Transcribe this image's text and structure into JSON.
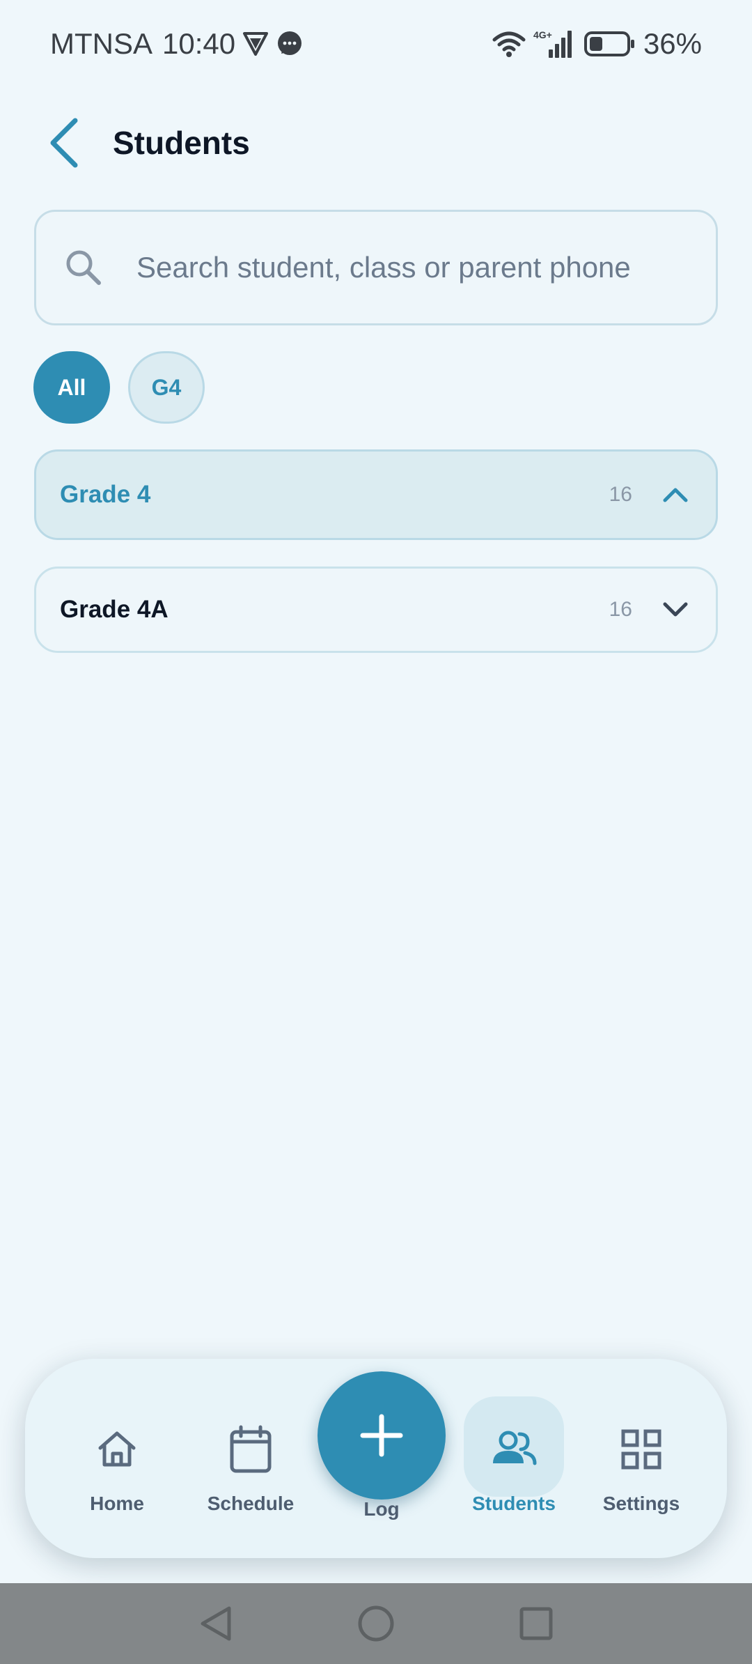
{
  "status_bar": {
    "carrier": "MTNSA",
    "time": "10:40",
    "network": "4G+",
    "battery_percent": "36%",
    "battery_level": 0.36,
    "icons": [
      "vpn-icon",
      "messenger-icon",
      "wifi-icon",
      "signal-icon",
      "battery-icon"
    ]
  },
  "header": {
    "title": "Students",
    "back_icon": "chevron-left-icon"
  },
  "search": {
    "placeholder": "Search student, class or parent phone",
    "value": "",
    "icon": "search-icon"
  },
  "filters": {
    "chips": [
      {
        "label": "All",
        "active": true
      },
      {
        "label": "G4",
        "active": false
      }
    ]
  },
  "groups": [
    {
      "name": "Grade 4",
      "count": "16",
      "expanded": true
    },
    {
      "name": "Grade 4A",
      "count": "16",
      "expanded": false
    }
  ],
  "bottom_nav": {
    "items": [
      {
        "label": "Home",
        "icon": "home-icon",
        "active": false
      },
      {
        "label": "Schedule",
        "icon": "calendar-icon",
        "active": false
      },
      {
        "label": "Log",
        "icon": "plus-icon",
        "active": false
      },
      {
        "label": "Students",
        "icon": "users-icon",
        "active": true
      },
      {
        "label": "Settings",
        "icon": "grid-icon",
        "active": false
      }
    ]
  },
  "colors": {
    "accent": "#2e8db3",
    "background": "#eff7fb",
    "text": "#0e1726",
    "muted": "#8a97a6"
  }
}
